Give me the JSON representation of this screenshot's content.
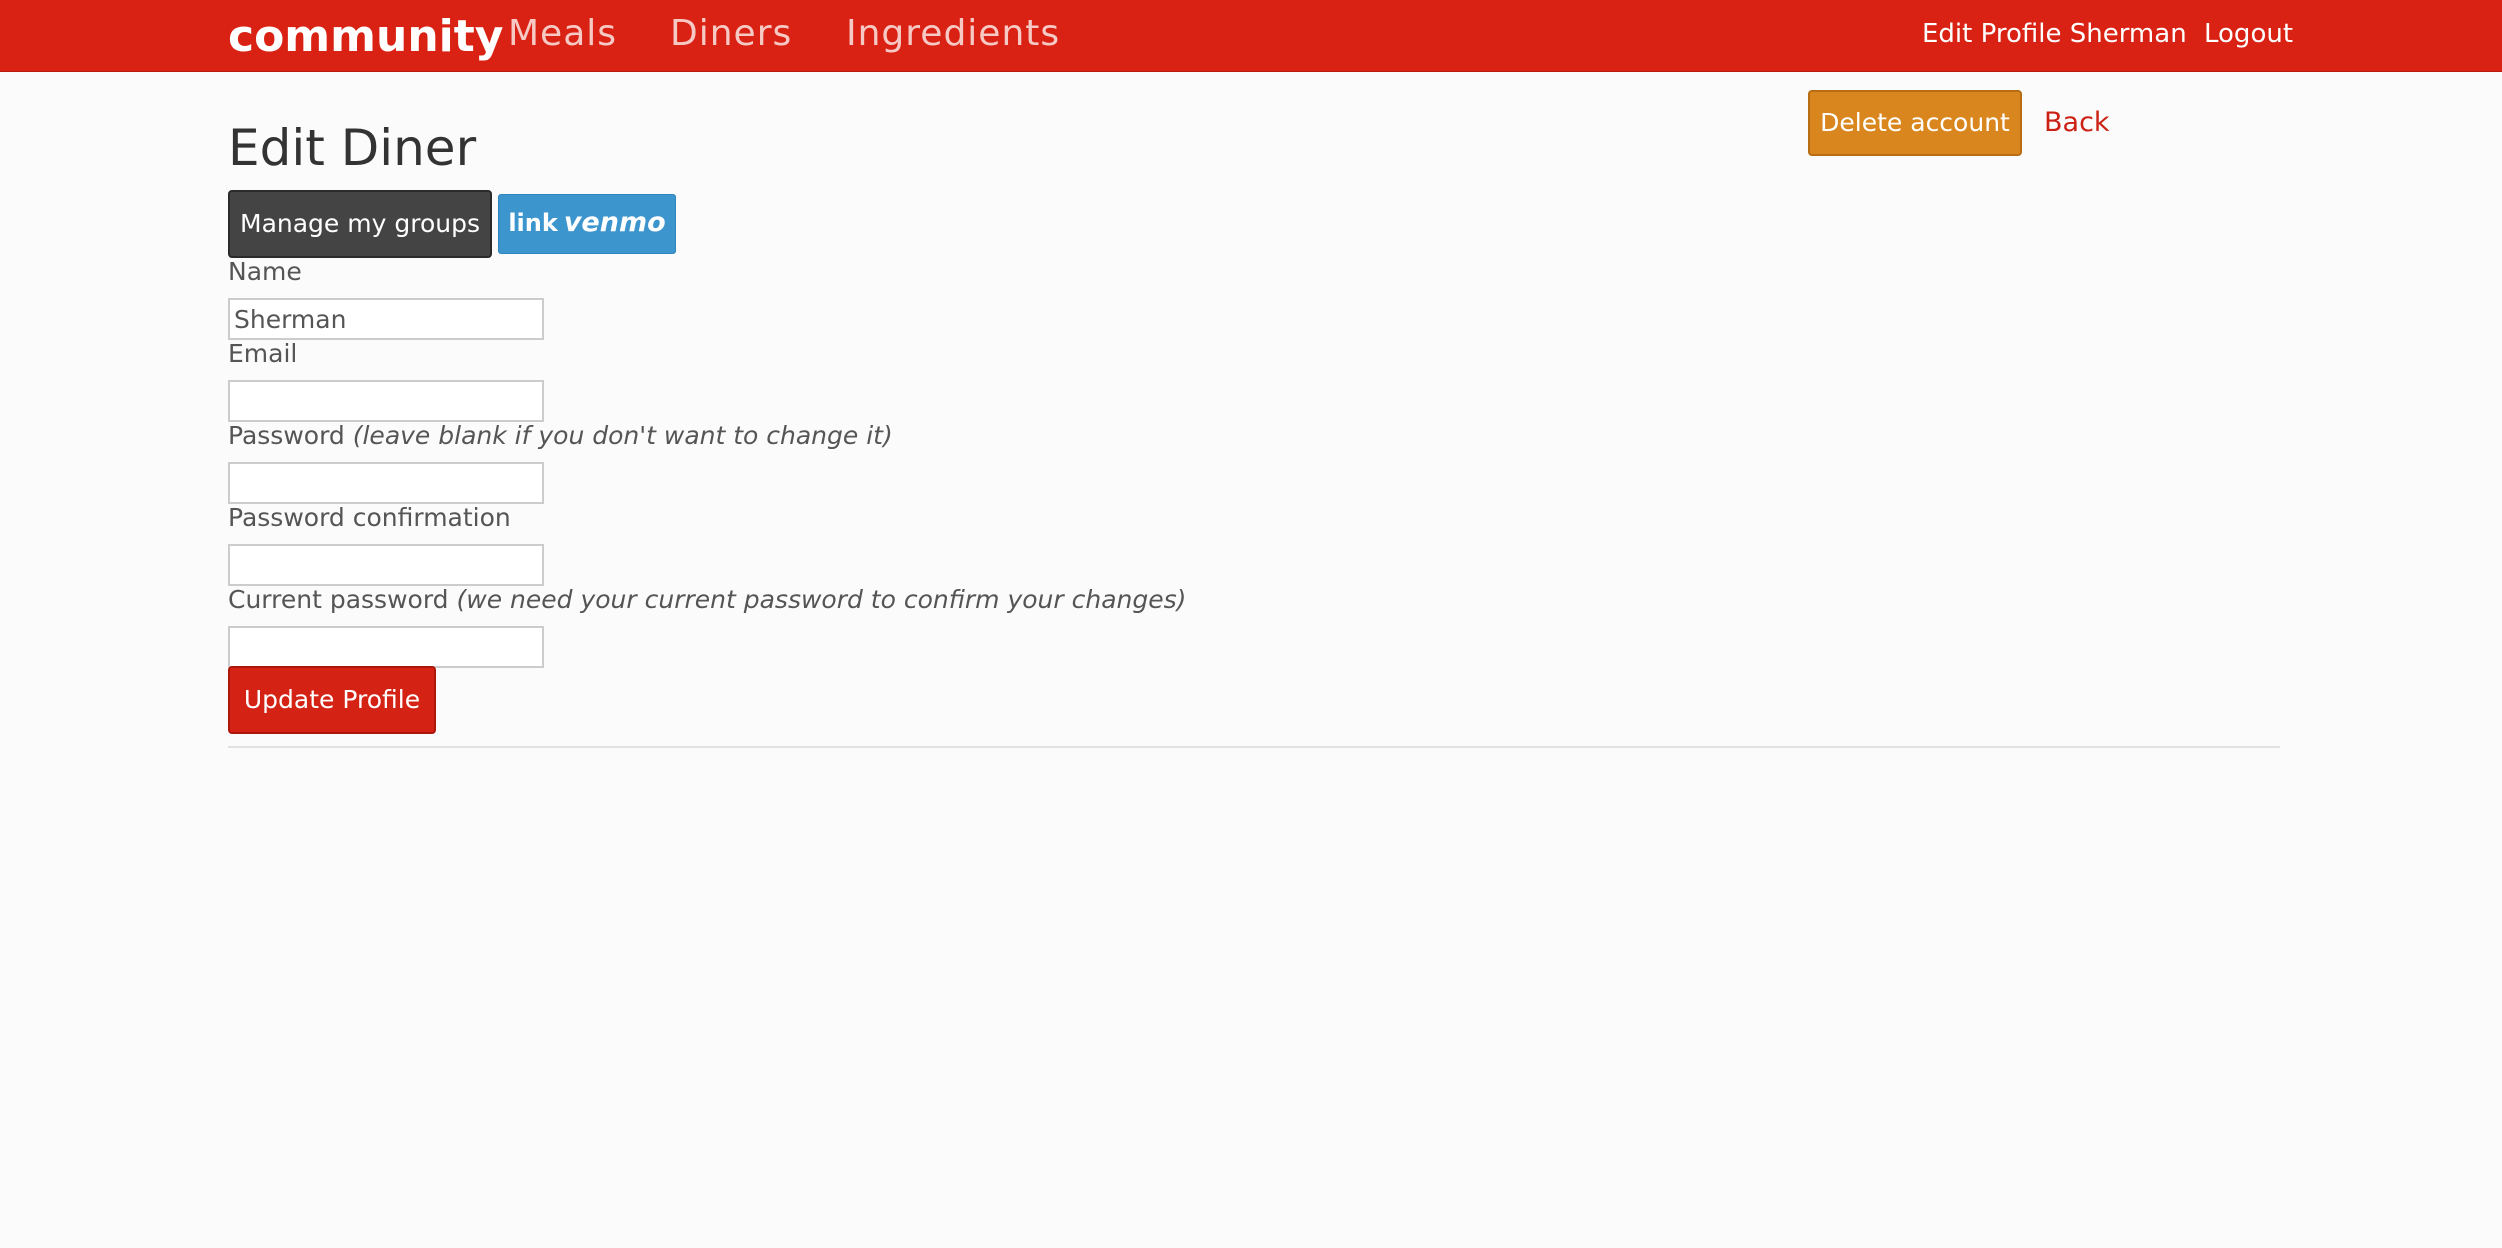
{
  "navbar": {
    "brand": "community",
    "links": [
      "Meals",
      "Diners",
      "Ingredients"
    ],
    "edit_profile": "Edit Profile Sherman",
    "logout": "Logout"
  },
  "page": {
    "title": "Edit Diner"
  },
  "actions": {
    "delete_account": "Delete account",
    "back": "Back",
    "manage_groups": "Manage my groups",
    "venmo_link": "link",
    "venmo_word": "venmo"
  },
  "form": {
    "name_label": "Name",
    "name_value": "Sherman",
    "email_label": "Email",
    "email_value": "",
    "password_label": "Password",
    "password_hint": "(leave blank if you don't want to change it)",
    "password_confirmation_label": "Password confirmation",
    "current_password_label": "Current password",
    "current_password_hint": "(we need your current password to confirm your changes)",
    "submit_label": "Update Profile"
  },
  "colors": {
    "navbar": "#d92214",
    "delete_button": "#d9861e",
    "dark_button": "#444444",
    "venmo_button": "#3d95ce",
    "primary_button": "#d42215",
    "link": "#cc2014"
  }
}
